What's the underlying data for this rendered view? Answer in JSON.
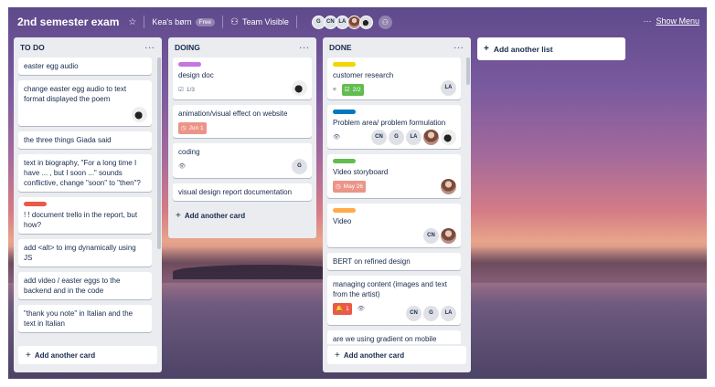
{
  "board": {
    "title": "2nd semester exam",
    "team": "Kea's børn",
    "team_badge": "Free",
    "visibility": "Team Visible",
    "members": [
      "G",
      "CN",
      "LA"
    ],
    "show_menu": "Show Menu"
  },
  "lists": [
    {
      "title": "TO DO",
      "cards": [
        {
          "text": "easter egg audio"
        },
        {
          "text": "change easter egg audio to text format displayed the poem"
        },
        {
          "text": "the three things Giada said"
        },
        {
          "text": "text in biography, \"For a long time I have ... , but I soon ...\" sounds conflictive, change \"soon\" to \"then\"?"
        },
        {
          "text": "! ! document trello in the report, but how?"
        },
        {
          "text": "add <alt> to img dynamically using JS"
        },
        {
          "text": "add video / easter eggs to the backend and in the code"
        },
        {
          "text": "\"thank you note\" in Italian and the text in Italian"
        }
      ],
      "add_card": "Add another card"
    },
    {
      "title": "DOING",
      "cards": [
        {
          "text": "design doc",
          "checklist": "1/3"
        },
        {
          "text": "animation/visual effect on website",
          "due": "Jun 1"
        },
        {
          "text": "coding",
          "member": "G"
        },
        {
          "text": "visual design report documentation"
        }
      ],
      "add_card": "Add another card"
    },
    {
      "title": "DONE",
      "cards": [
        {
          "text": "customer research",
          "checklist": "2/2",
          "member": "LA"
        },
        {
          "text": "Problem area/ problem formulation",
          "members": [
            "CN",
            "G",
            "LA"
          ]
        },
        {
          "text": "Video storyboard",
          "due": "May 26"
        },
        {
          "text": "Video",
          "member": "CN"
        },
        {
          "text": "BERT on refined design"
        },
        {
          "text": "managing content (images and text from the artist)",
          "notifications": "1",
          "members": [
            "CN",
            "G",
            "LA"
          ]
        },
        {
          "text": "are we using gradient on mobile"
        }
      ],
      "add_card": "Add another card"
    }
  ],
  "add_list": "Add another list",
  "colors": {
    "label_purple": "#c377e0",
    "label_red": "#eb5a46",
    "label_yellow": "#f2d600",
    "label_blue": "#0079bf",
    "label_green": "#61bd4f",
    "label_orange": "#ffab4a"
  }
}
